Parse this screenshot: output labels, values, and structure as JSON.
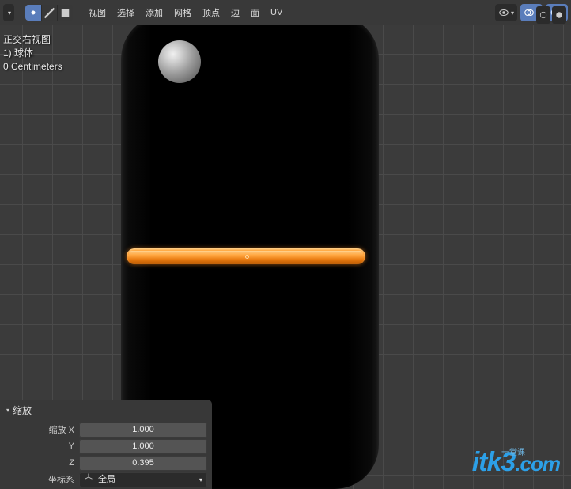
{
  "header": {
    "menus": [
      "视图",
      "选择",
      "添加",
      "网格",
      "顶点",
      "边",
      "面",
      "UV"
    ]
  },
  "overlay": {
    "line1": "正交右视图",
    "line2": "1) 球体",
    "line3": "0 Centimeters"
  },
  "transform": {
    "title": "缩放",
    "rows": [
      {
        "label": "缩放 X",
        "value": "1.000"
      },
      {
        "label": "Y",
        "value": "1.000"
      },
      {
        "label": "Z",
        "value": "0.395"
      }
    ],
    "orientation_label": "坐标系",
    "orientation_value": "全局"
  },
  "watermark": {
    "brand": "itk3",
    "tld": ".com",
    "tagline": "一堂课"
  },
  "icons": {
    "visibility": "visibility-icon",
    "overlays": "overlays-icon",
    "shading": "shading-icon"
  }
}
